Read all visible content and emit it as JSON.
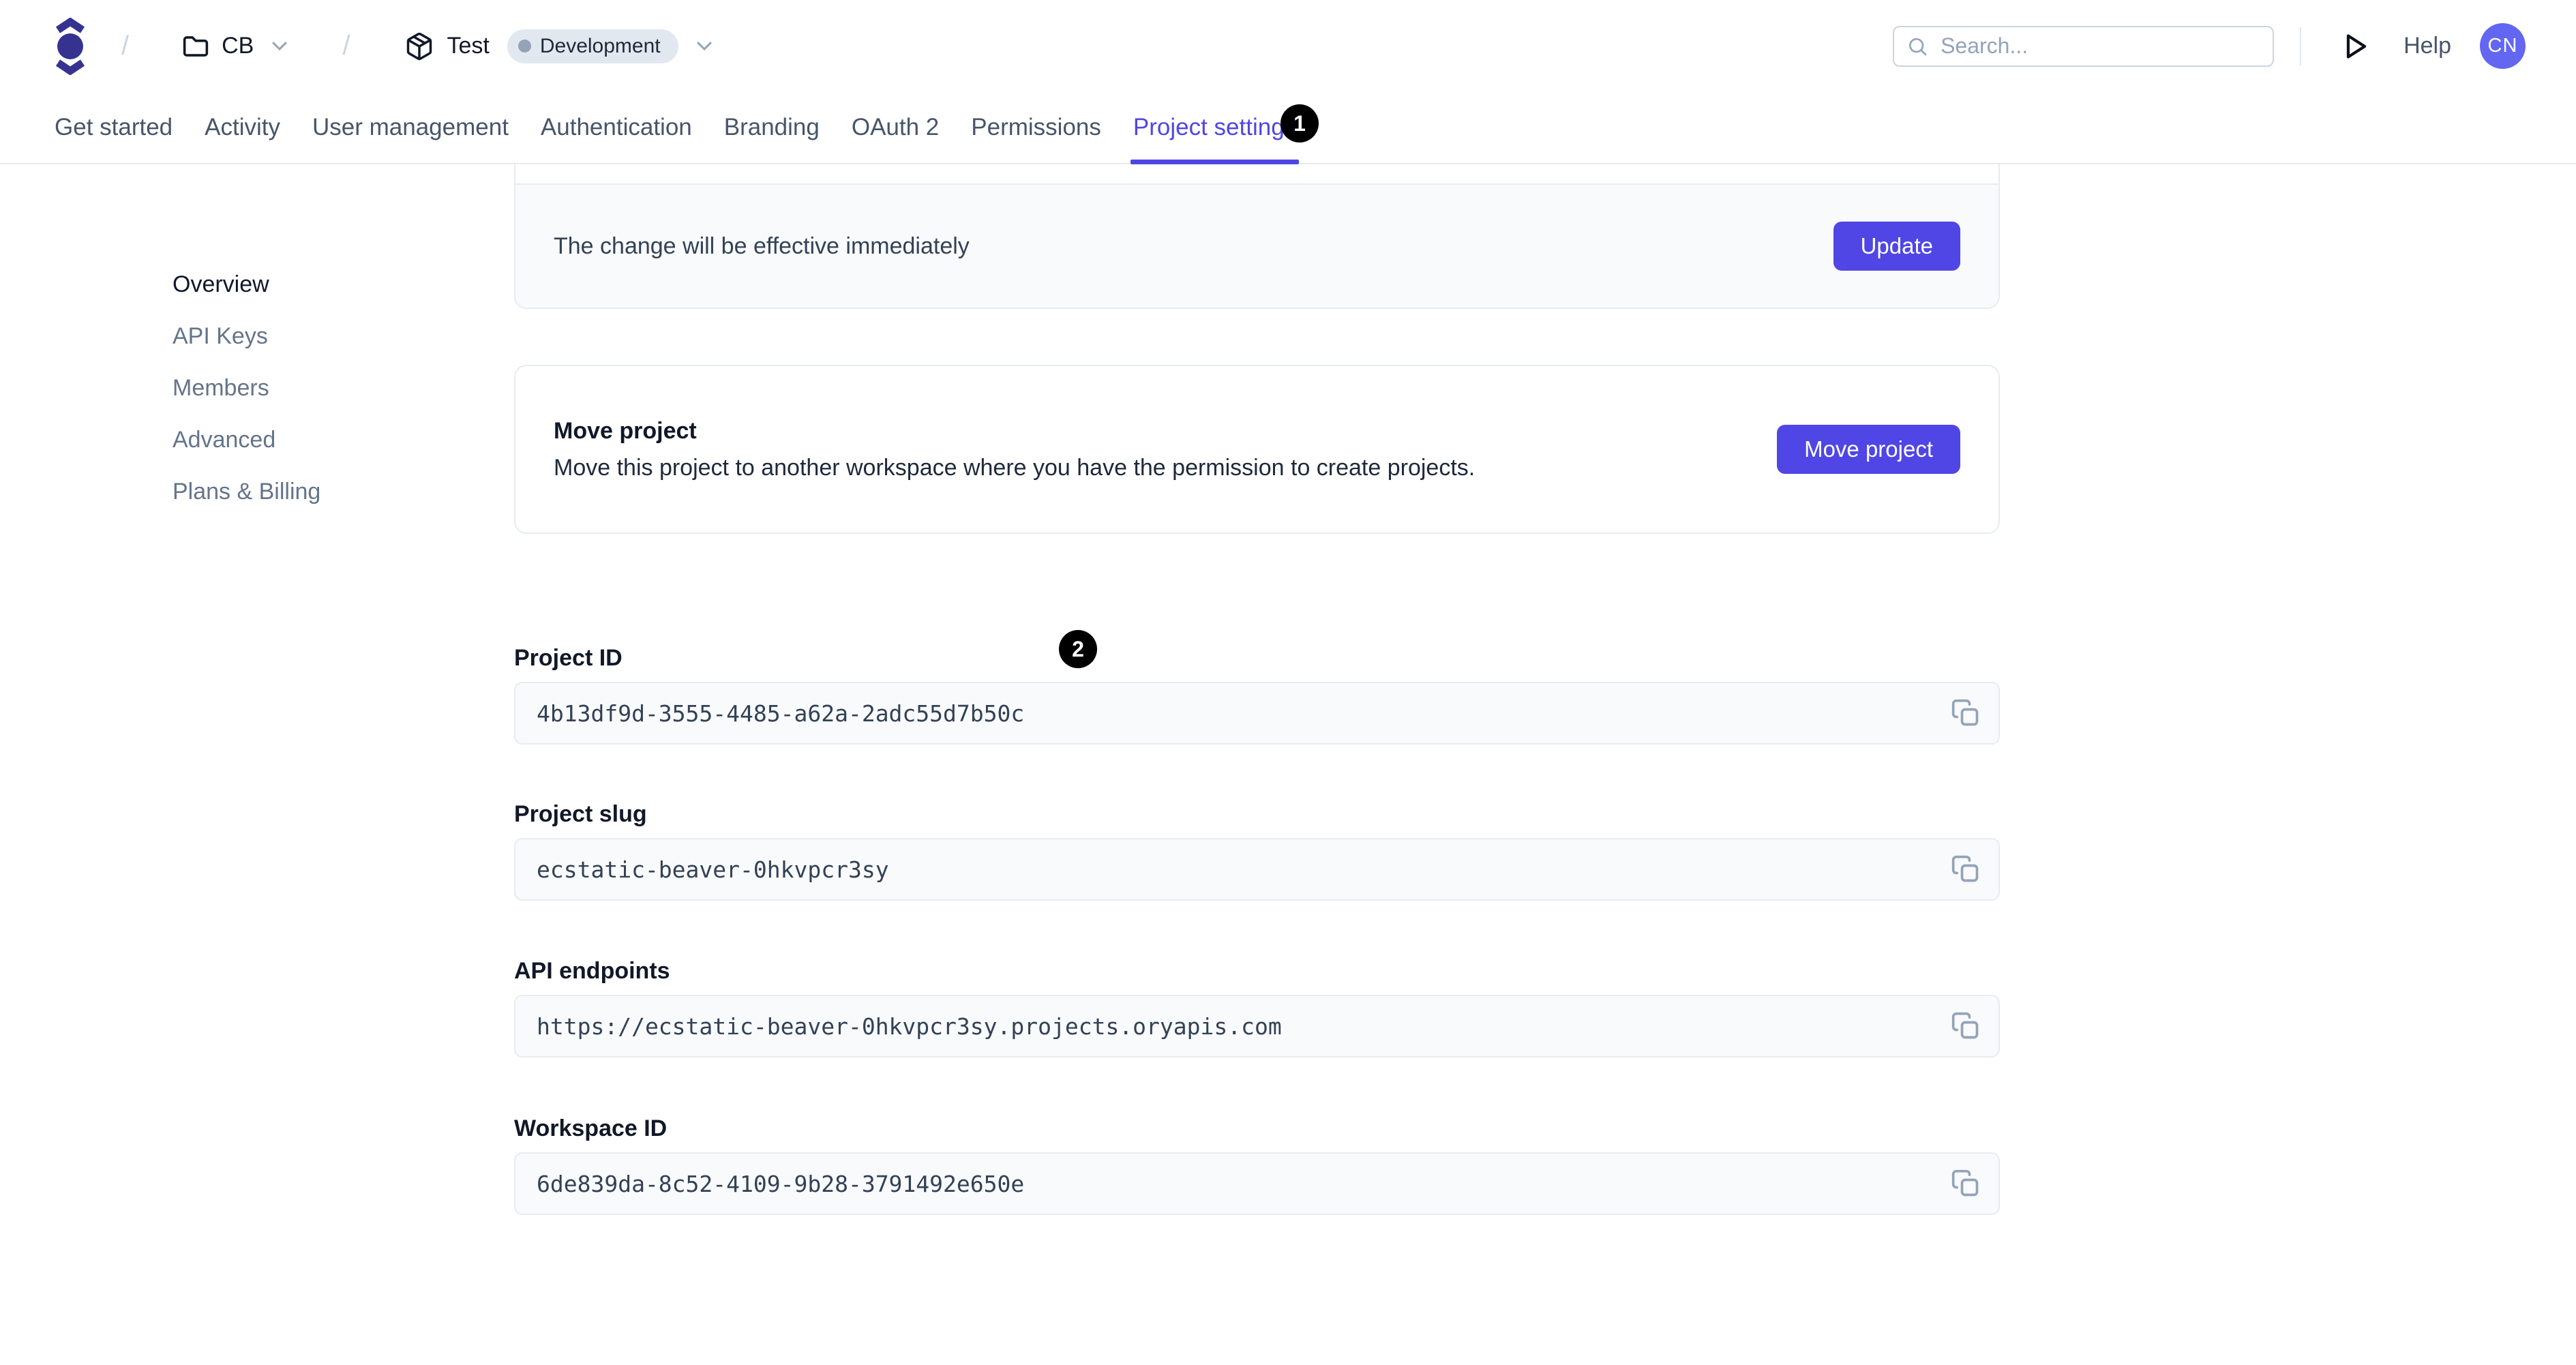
{
  "colors": {
    "accent": "#4F46E5",
    "logo": "#363390",
    "avatar_bg": "#6366F1",
    "badge_bg": "#E2E8F0",
    "annotation_badge": "#000000"
  },
  "header": {
    "separator": "/",
    "workspace": {
      "label": "CB"
    },
    "project": {
      "label": "Test",
      "environment": "Development"
    },
    "search_placeholder": "Search...",
    "help_label": "Help",
    "avatar_initials": "CN"
  },
  "tabs": [
    {
      "label": "Get started"
    },
    {
      "label": "Activity"
    },
    {
      "label": "User management"
    },
    {
      "label": "Authentication"
    },
    {
      "label": "Branding"
    },
    {
      "label": "OAuth 2"
    },
    {
      "label": "Permissions"
    },
    {
      "label": "Project settings",
      "active": true
    }
  ],
  "annotations": {
    "badge1": "1",
    "badge2": "2"
  },
  "sidebar": [
    {
      "label": "Overview",
      "active": true
    },
    {
      "label": "API Keys"
    },
    {
      "label": "Members"
    },
    {
      "label": "Advanced"
    },
    {
      "label": "Plans & Billing"
    }
  ],
  "update_card": {
    "message": "The change will be effective immediately",
    "button": "Update"
  },
  "move_card": {
    "title": "Move project",
    "description": "Move this project to another workspace where you have the permission to create projects.",
    "button": "Move project"
  },
  "fields": [
    {
      "label": "Project ID",
      "value": "4b13df9d-3555-4485-a62a-2adc55d7b50c"
    },
    {
      "label": "Project slug",
      "value": "ecstatic-beaver-0hkvpcr3sy"
    },
    {
      "label": "API endpoints",
      "value": "https://ecstatic-beaver-0hkvpcr3sy.projects.oryapis.com"
    },
    {
      "label": "Workspace ID",
      "value": "6de839da-8c52-4109-9b28-3791492e650e"
    }
  ],
  "icons": {
    "logo": "ory-logo (circle with chevrons)",
    "workspace": "folder",
    "project": "package-cube",
    "dropdown": "chevron-down",
    "search": "magnifier",
    "play": "play-triangle-outline",
    "copy": "copy-duplicate"
  }
}
